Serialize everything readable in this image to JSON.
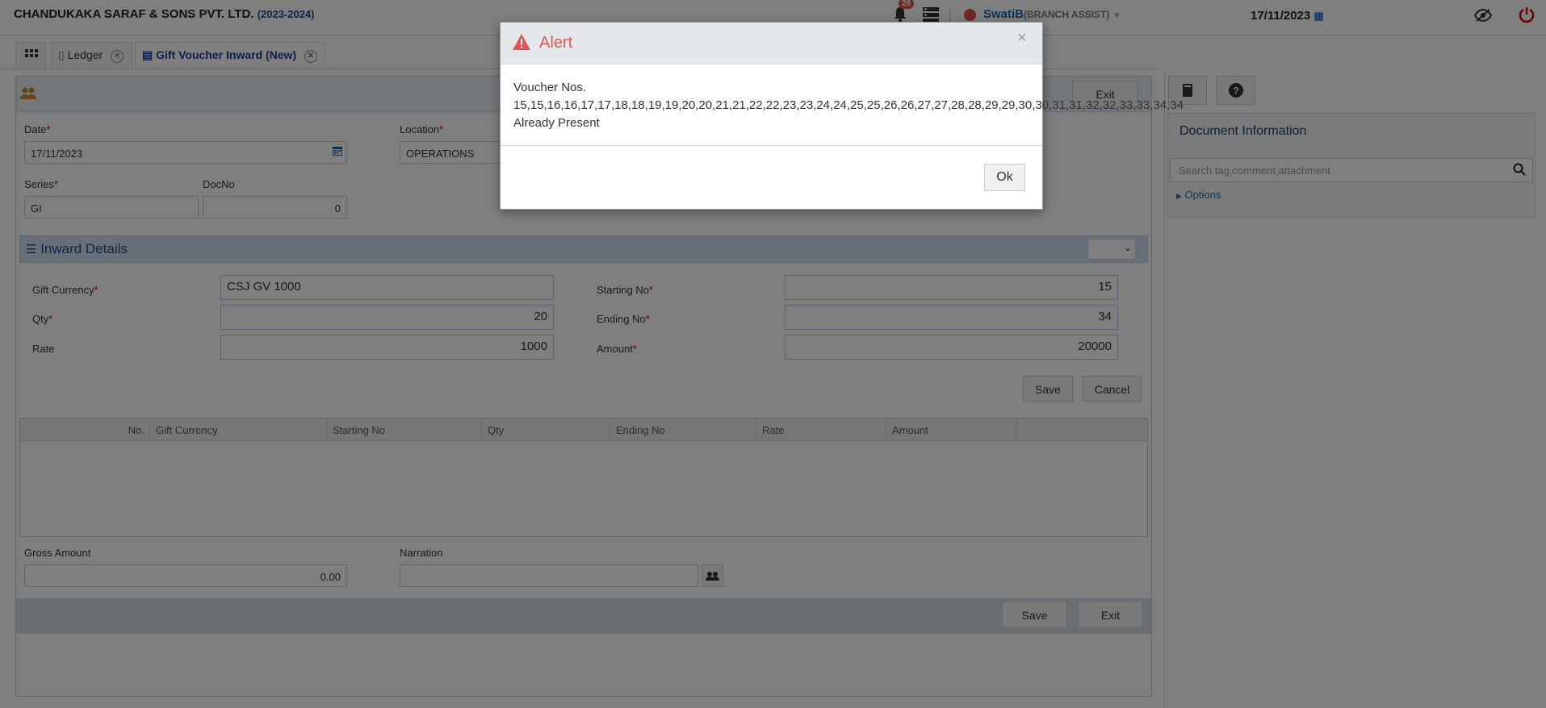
{
  "header": {
    "company": "CHANDUKAKA SARAF & SONS PVT. LTD.",
    "year": "(2023-2024)",
    "notification_count": "28",
    "user_name": "SwatiB",
    "user_role": "(BRANCH ASSIST)",
    "date": "17/11/2023"
  },
  "tabs": [
    {
      "label": "Ledger"
    },
    {
      "label": "Gift Voucher Inward (New)"
    }
  ],
  "toolbar": {
    "exit_label": "Exit"
  },
  "form": {
    "date_label": "Date",
    "date_value": "17/11/2023",
    "location_label": "Location",
    "location_value": "OPERATIONS",
    "series_label": "Series",
    "series_value": "GI",
    "docno_label": "DocNo",
    "docno_value": "0"
  },
  "inward": {
    "title": "Inward Details",
    "gift_currency_label": "Gift Currency",
    "gift_currency_value": "CSJ GV 1000",
    "qty_label": "Qty",
    "qty_value": "20",
    "rate_label": "Rate",
    "rate_value": "1000",
    "starting_no_label": "Starting No",
    "starting_no_value": "15",
    "ending_no_label": "Ending No",
    "ending_no_value": "34",
    "amount_label": "Amount",
    "amount_value": "20000",
    "save_label": "Save",
    "cancel_label": "Cancel"
  },
  "grid": {
    "columns": [
      "No.",
      "Gift Currency",
      "Starting No",
      "Qty",
      "Ending No",
      "Rate",
      "Amount"
    ]
  },
  "totals": {
    "gross_amount_label": "Gross Amount",
    "gross_amount_value": "0.00",
    "narration_label": "Narration",
    "narration_value": ""
  },
  "footer": {
    "save_label": "Save",
    "exit_label": "Exit"
  },
  "right_panel": {
    "title": "Document Information",
    "search_placeholder": "Search tag,comment,attachment",
    "options_label": "Options"
  },
  "alert": {
    "title": "Alert",
    "close": "×",
    "line1": "Voucher Nos.",
    "line2": "15,15,16,16,17,17,18,18,19,19,20,20,21,21,22,22,23,23,24,24,25,25,26,26,27,27,28,28,29,29,30,30,31,31,32,32,33,33,34,34",
    "line3": "Already Present",
    "ok_label": "Ok"
  },
  "colors": {
    "accent": "#1f3f99",
    "alert_red": "#e05555",
    "section_bg": "#cfe0f0"
  }
}
